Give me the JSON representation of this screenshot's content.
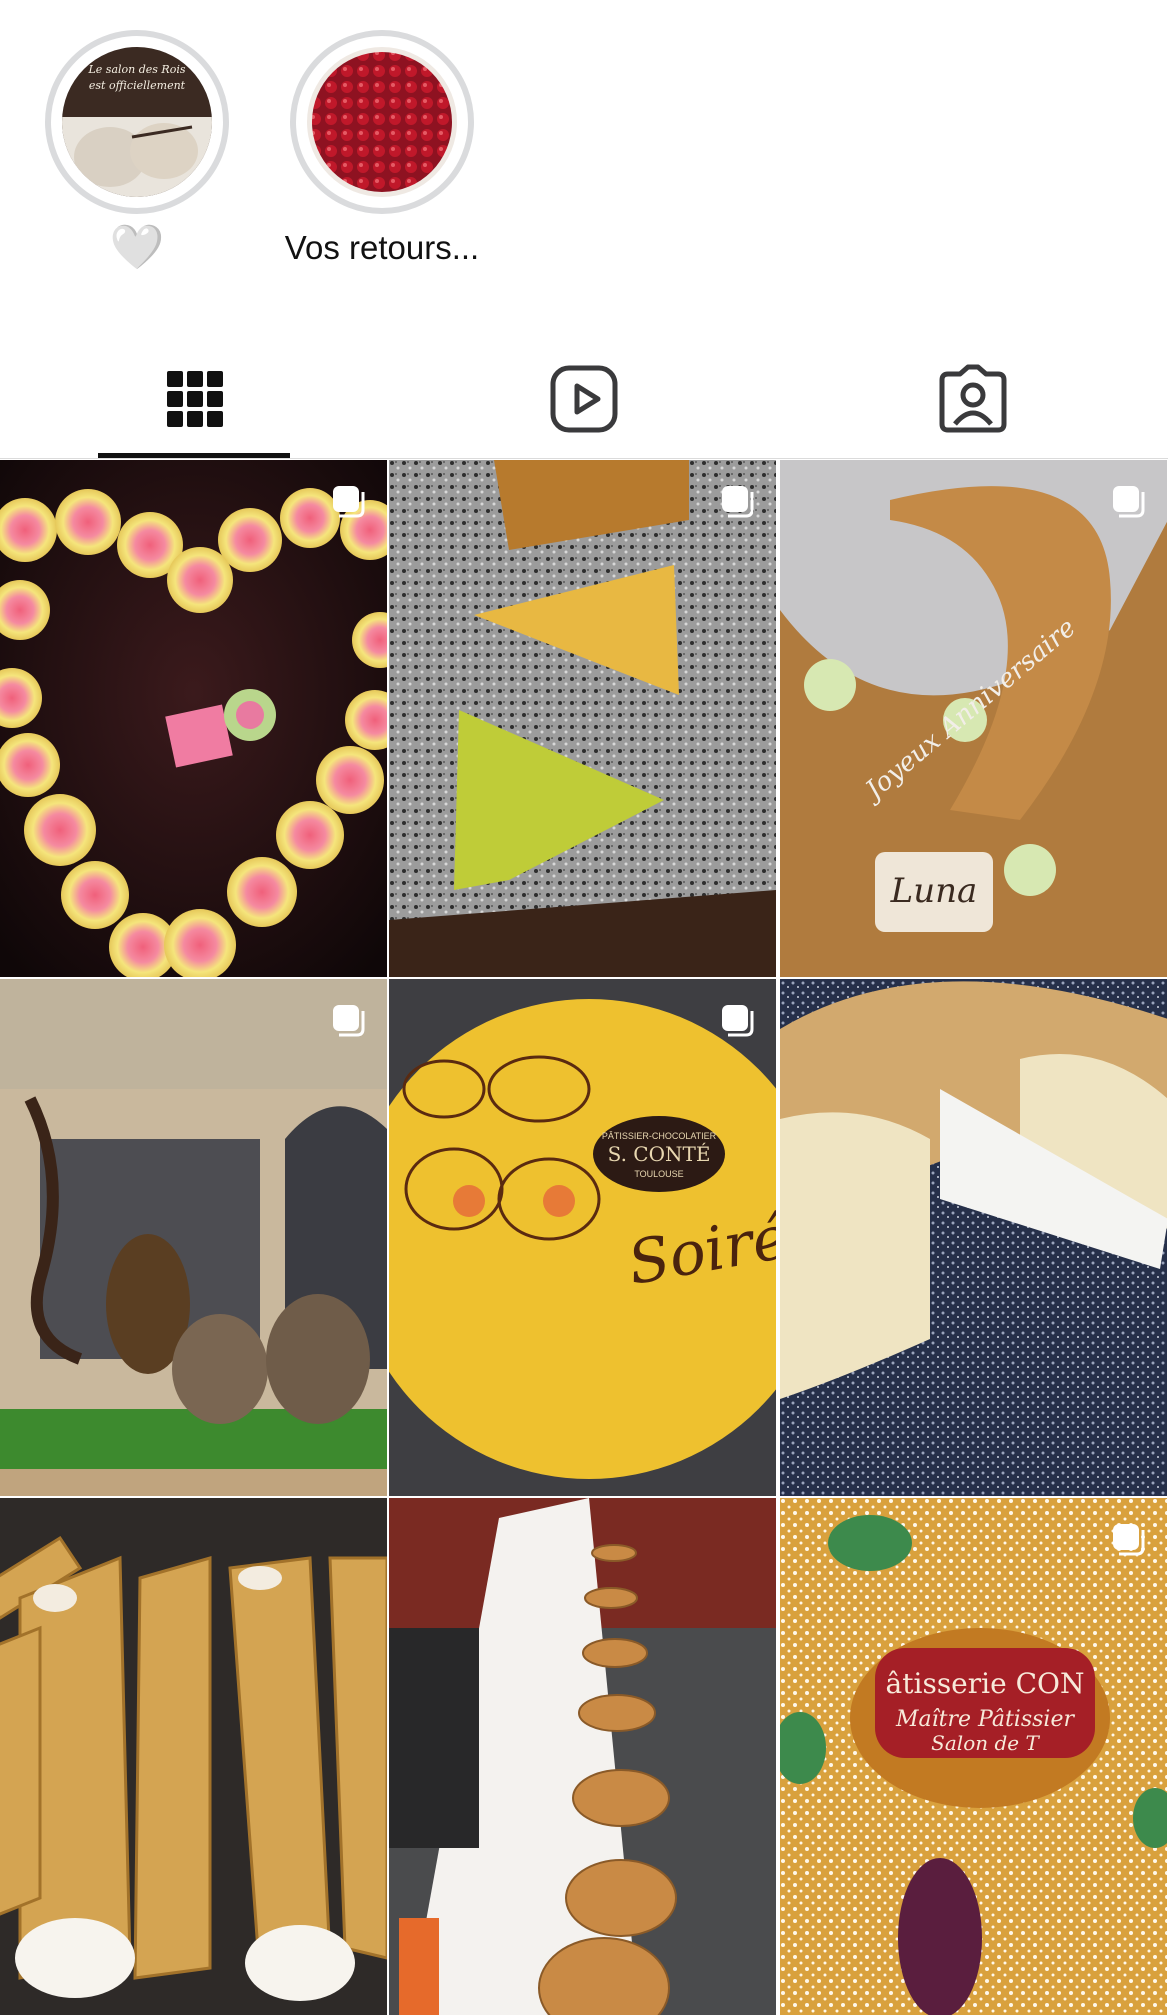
{
  "highlights": [
    {
      "label": "🤍",
      "icon": "heart-icon",
      "kind": "emoji"
    },
    {
      "label": "Vos retours..."
    }
  ],
  "tabs": [
    {
      "icon": "grid-icon",
      "active": true
    },
    {
      "icon": "reels-icon",
      "active": false
    },
    {
      "icon": "tagged-icon",
      "active": false
    }
  ],
  "colors": {
    "ring": "#dadbdd",
    "active_indicator": "#111111",
    "icon": "#3a3a3c"
  },
  "posts": [
    {
      "subject": "pink macarons heart",
      "multiple": true
    },
    {
      "subject": "tart slices on granite",
      "multiple": true
    },
    {
      "subject": "sculpted anniversary pastry Luna",
      "multiple": true
    },
    {
      "subject": "chocolate storefront display",
      "multiple": true
    },
    {
      "subject": "S. Conté signed cake",
      "multiple": true
    },
    {
      "subject": "brioche ring",
      "multiple": false
    },
    {
      "subject": "rolled crepes",
      "multiple": false
    },
    {
      "subject": "galettes in boxes",
      "multiple": false
    },
    {
      "subject": "brioche des rois",
      "multiple": true
    }
  ],
  "post_texts": {
    "conte_seal_top": "PÂTISSIER-CHOCOLATIER",
    "conte_seal_name": "S. CONTÉ",
    "conte_seal_city": "TOULOUSE",
    "conte_script": "Soirée",
    "luna_plaque": "Luna",
    "anniv_script": "Joyeux Anniversaire",
    "brioche_label_1": "âtisserie CON",
    "brioche_label_2": "Maître Pâtissier",
    "brioche_label_3": "Salon de T"
  }
}
